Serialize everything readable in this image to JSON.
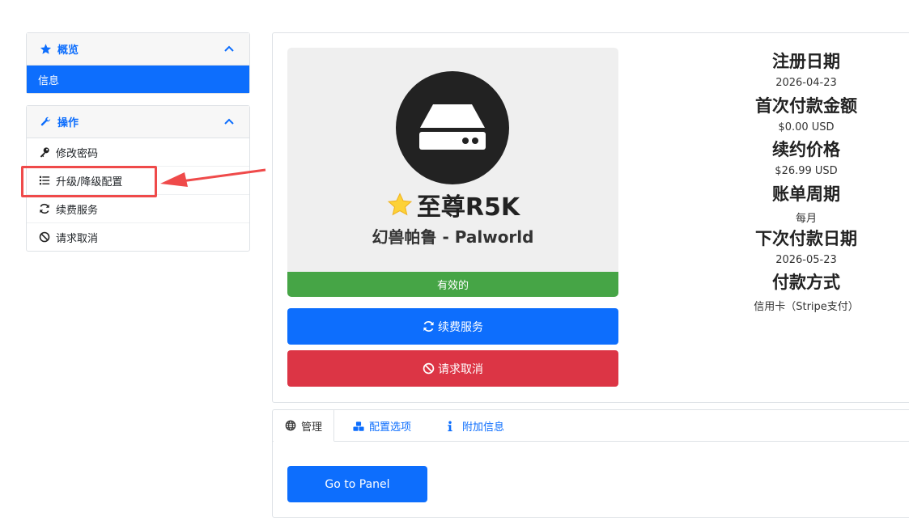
{
  "sidebar": {
    "overview": {
      "title": "概览",
      "icon": "star-icon",
      "items": [
        {
          "label": "信息",
          "active": true
        }
      ]
    },
    "actions": {
      "title": "操作",
      "icon": "wrench-icon",
      "items": [
        {
          "label": "修改密码",
          "icon": "key-icon"
        },
        {
          "label": "升级/降级配置",
          "icon": "list-icon"
        },
        {
          "label": "续费服务",
          "icon": "refresh-icon"
        },
        {
          "label": "请求取消",
          "icon": "ban-icon"
        }
      ]
    }
  },
  "product": {
    "icon": "hdd-icon",
    "name": "至尊R5K",
    "group": "幻兽帕鲁 - Palworld",
    "status": "有效的"
  },
  "buttons": {
    "renew": "续费服务",
    "cancel": "请求取消",
    "panel": "Go to Panel"
  },
  "info": {
    "registration_date_label": "注册日期",
    "registration_date": "2026-04-23",
    "first_payment_label": "首次付款金额",
    "first_payment": "$0.00 USD",
    "renewal_price_label": "续约价格",
    "renewal_price": "$26.99 USD",
    "billing_cycle_label": "账单周期",
    "billing_cycle": "每月",
    "next_due_label": "下次付款日期",
    "next_due": "2026-05-23",
    "payment_method_label": "付款方式",
    "payment_method": "信用卡（Stripe支付）"
  },
  "tabs": [
    {
      "label": "管理",
      "icon": "globe-icon",
      "active": true
    },
    {
      "label": "配置选项",
      "icon": "cubes-icon"
    },
    {
      "label": "附加信息",
      "icon": "info-icon"
    }
  ],
  "colors": {
    "primary": "#0d6efd",
    "success": "#46a546",
    "danger": "#dc3545",
    "annotation": "#ef4a4a"
  }
}
